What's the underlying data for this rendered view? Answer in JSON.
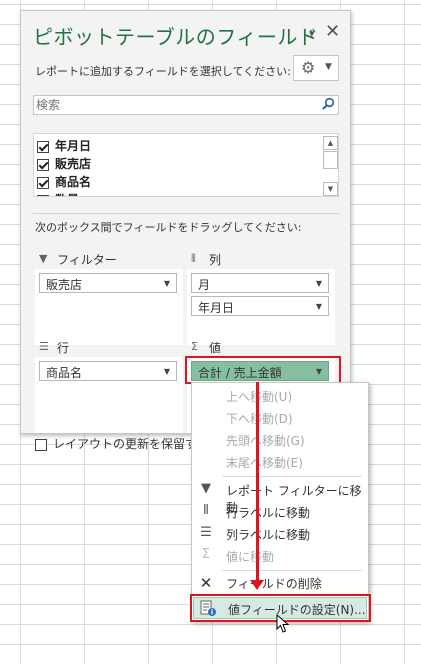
{
  "pane": {
    "title": "ピボットテーブルのフィールド",
    "chevron": "▾",
    "close": "✕",
    "instruction": "レポートに追加するフィールドを選択してください:",
    "search_placeholder": "検索",
    "fields": [
      {
        "label": "年月日",
        "checked": true
      },
      {
        "label": "販売店",
        "checked": true
      },
      {
        "label": "商品名",
        "checked": true
      },
      {
        "label": "数量",
        "checked": false
      }
    ],
    "drag_instruction": "次のボックス間でフィールドをドラッグしてください:",
    "areas": {
      "filter": {
        "label": "フィルター",
        "items": [
          "販売店"
        ]
      },
      "columns": {
        "label": "列",
        "items": [
          "月",
          "年月日"
        ]
      },
      "rows": {
        "label": "行",
        "items": [
          "商品名"
        ]
      },
      "values": {
        "label": "値",
        "items": [
          "合計 / 売上金額"
        ]
      }
    },
    "defer_update": "レイアウトの更新を保留する"
  },
  "icons": {
    "gear": "gear-icon",
    "search": "search-icon",
    "filter": "filter-icon",
    "columns": "columns-icon",
    "rows": "rows-icon",
    "sigma": "sigma-icon"
  },
  "context_menu": {
    "items": [
      {
        "label": "上へ移動(U)",
        "disabled": true,
        "icon": ""
      },
      {
        "label": "下へ移動(D)",
        "disabled": true,
        "icon": ""
      },
      {
        "label": "先頭へ移動(G)",
        "disabled": true,
        "icon": ""
      },
      {
        "label": "末尾へ移動(E)",
        "disabled": true,
        "icon": ""
      },
      {
        "label": "レポート フィルターに移動",
        "disabled": false,
        "icon": "filter-icon"
      },
      {
        "label": "行ラベルに移動",
        "disabled": false,
        "icon": "columns-icon"
      },
      {
        "label": "列ラベルに移動",
        "disabled": false,
        "icon": "rows-icon"
      },
      {
        "label": "値に移動",
        "disabled": true,
        "icon": "sigma-icon"
      },
      {
        "label": "フィールドの削除",
        "disabled": false,
        "icon": "close-icon"
      },
      {
        "label": "値フィールドの設定(N)...",
        "disabled": false,
        "icon": "field-settings-icon",
        "highlighted": true
      }
    ]
  },
  "colors": {
    "title_green": "#217346",
    "selected_chip": "#86bfa0",
    "highlight_red": "#e0141e",
    "menu_highlight": "#d6ebdf"
  }
}
